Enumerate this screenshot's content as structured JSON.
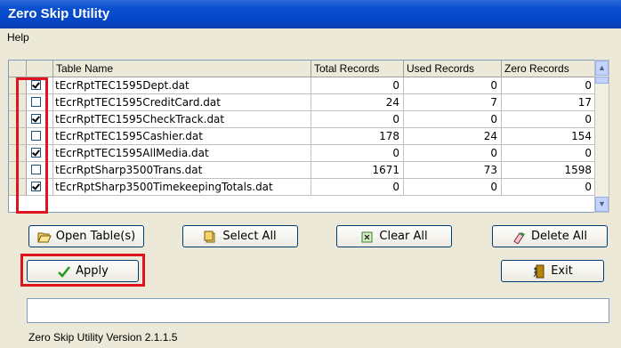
{
  "window": {
    "title": "Zero Skip Utility"
  },
  "menu": {
    "help": "Help"
  },
  "table": {
    "headers": [
      "Table Name",
      "Total Records",
      "Used Records",
      "Zero Records"
    ],
    "rows": [
      {
        "checked": true,
        "name": "tEcrRptTEC1595Dept.dat",
        "total": "0",
        "used": "0",
        "zero": "0"
      },
      {
        "checked": false,
        "name": "tEcrRptTEC1595CreditCard.dat",
        "total": "24",
        "used": "7",
        "zero": "17"
      },
      {
        "checked": true,
        "name": "tEcrRptTEC1595CheckTrack.dat",
        "total": "0",
        "used": "0",
        "zero": "0"
      },
      {
        "checked": false,
        "name": "tEcrRptTEC1595Cashier.dat",
        "total": "178",
        "used": "24",
        "zero": "154"
      },
      {
        "checked": true,
        "name": "tEcrRptTEC1595AllMedia.dat",
        "total": "0",
        "used": "0",
        "zero": "0"
      },
      {
        "checked": false,
        "name": "tEcrRptSharp3500Trans.dat",
        "total": "1671",
        "used": "73",
        "zero": "1598"
      },
      {
        "checked": true,
        "name": "tEcrRptSharp3500TimekeepingTotals.dat",
        "total": "0",
        "used": "0",
        "zero": "0"
      }
    ]
  },
  "buttons": {
    "open": "Open Table(s)",
    "select_all": "Select All",
    "clear_all": "Clear All",
    "delete_all": "Delete All",
    "apply": "Apply",
    "exit": "Exit"
  },
  "status": {
    "text": ""
  },
  "version": "Zero Skip Utility Version  2.1.1.5",
  "colors": {
    "title_bar": "#0a4fd0",
    "highlight": "#e0141e",
    "apply_check": "#1e9a1e"
  }
}
